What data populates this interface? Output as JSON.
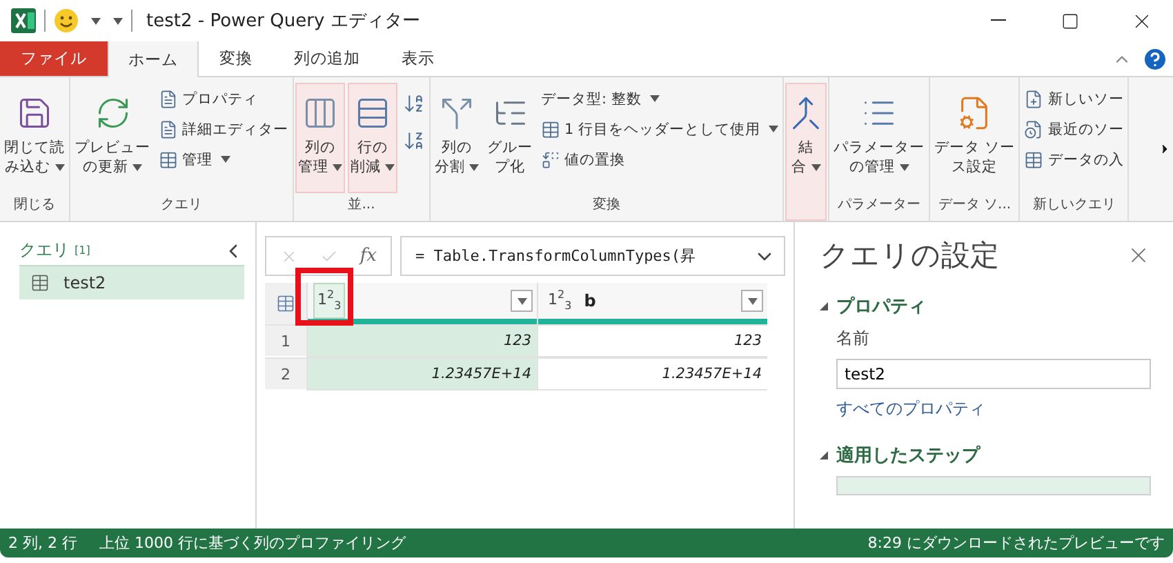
{
  "window": {
    "title": "test2 - Power Query エディター"
  },
  "tabs": [
    {
      "label": "ファイル",
      "kind": "file",
      "selected": false
    },
    {
      "label": "ホーム",
      "kind": "tab",
      "selected": true
    },
    {
      "label": "変換",
      "kind": "tab",
      "selected": false
    },
    {
      "label": "列の追加",
      "kind": "tab",
      "selected": false
    },
    {
      "label": "表示",
      "kind": "tab",
      "selected": false
    }
  ],
  "ribbon": {
    "groups": [
      {
        "label": "閉じる",
        "items": [
          {
            "kind": "large",
            "lines": [
              "閉じて読",
              "み込む"
            ],
            "dropdown": true,
            "highlighted": false
          }
        ]
      },
      {
        "label": "クエリ",
        "items": [
          {
            "kind": "large",
            "lines": [
              "プレビュー",
              "の更新"
            ],
            "dropdown": true,
            "highlighted": false
          },
          {
            "kind": "stack",
            "entries": [
              {
                "label": "プロパティ",
                "dropdown": false
              },
              {
                "label": "詳細エディター",
                "dropdown": false
              },
              {
                "label": "管理",
                "dropdown": true
              }
            ]
          }
        ]
      },
      {
        "label": "並...",
        "items": [
          {
            "kind": "large",
            "lines": [
              "列の",
              "管理"
            ],
            "dropdown": true,
            "highlighted": true
          },
          {
            "kind": "large",
            "lines": [
              "行の",
              "削減"
            ],
            "dropdown": true,
            "highlighted": true
          },
          {
            "kind": "sort"
          }
        ]
      },
      {
        "label": "変換",
        "items": [
          {
            "kind": "large",
            "lines": [
              "列の",
              "分割"
            ],
            "dropdown": true,
            "highlighted": false
          },
          {
            "kind": "large",
            "lines": [
              "グルー",
              "プ化"
            ],
            "dropdown": false,
            "highlighted": false
          },
          {
            "kind": "stack",
            "entries": [
              {
                "label": "データ型: 整数",
                "dropdown": true
              },
              {
                "label": "1 行目をヘッダーとして使用",
                "dropdown": true
              },
              {
                "label": "値の置換",
                "dropdown": false
              }
            ]
          }
        ]
      },
      {
        "items": [
          {
            "kind": "large",
            "lines": [
              "結",
              "合"
            ],
            "dropdown": true,
            "highlighted": true
          }
        ]
      },
      {
        "label": "パラメーター",
        "items": [
          {
            "kind": "large",
            "lines": [
              "パラメーター",
              "の管理"
            ],
            "dropdown": true,
            "highlighted": false
          }
        ]
      },
      {
        "label": "データ ソ...",
        "items": [
          {
            "kind": "large",
            "lines": [
              "データ ソー",
              "ス設定"
            ],
            "dropdown": false,
            "highlighted": false
          }
        ]
      },
      {
        "label": "新しいクエリ",
        "items": [
          {
            "kind": "stack",
            "entries": [
              {
                "label": "新しいソー",
                "dropdown": false
              },
              {
                "label": "最近のソー",
                "dropdown": false
              },
              {
                "label": "データの入",
                "dropdown": false
              }
            ]
          }
        ]
      }
    ]
  },
  "queries": {
    "header": "クエリ",
    "count": "[1]",
    "items": [
      {
        "label": "test2",
        "selected": true
      }
    ]
  },
  "formula_bar": {
    "fx": "fx",
    "formula": "= Table.TransformColumnTypes(昇"
  },
  "table": {
    "columns": [
      {
        "type_icon": "1$^{2}$$_{3}$",
        "selected": true,
        "level": 1,
        "highlight_frame": true
      },
      {
        "type_icon": "1$^{2}$$_{3}$",
        "name": "b",
        "selected": false,
        "level": 1,
        "highlight_frame": false
      }
    ],
    "rows": [
      {
        "number": "1",
        "cells": [
          "123",
          "123"
        ]
      },
      {
        "number": "2",
        "cells": [
          "1.23457E+14",
          "1.23457E+14"
        ]
      }
    ]
  },
  "settings": {
    "title": "クエリの設定",
    "properties": {
      "heading": "プロパティ",
      "expanded": true,
      "name_label": "名前",
      "name_value": "test2",
      "link": "すべてのプロパティ"
    },
    "steps": {
      "heading": "適用したステップ",
      "expanded": true
    }
  },
  "status_bar": {
    "left": [
      "2 列, 2 行",
      "上位 1000 行に基づく列のプロファイリング"
    ],
    "right": "8:29 にダウンロードされたプレビューです"
  }
}
